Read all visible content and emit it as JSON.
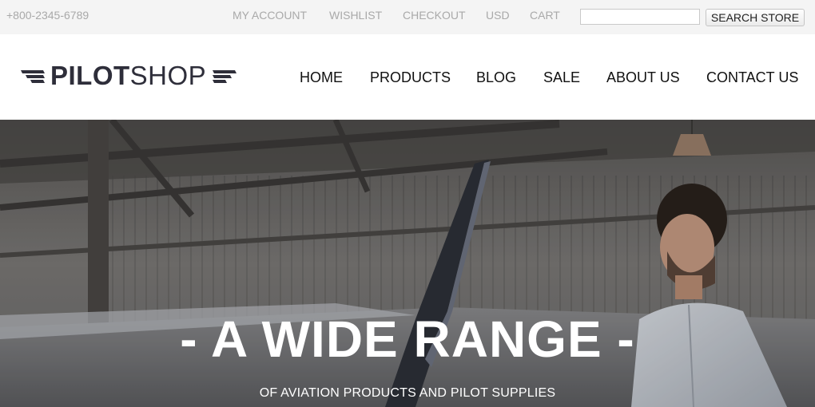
{
  "topbar": {
    "phone": "+800-2345-6789",
    "links": {
      "my_account": "MY ACCOUNT",
      "wishlist": "WISHLIST",
      "checkout": "CHECKOUT",
      "currency": "USD",
      "cart": "CART"
    },
    "search": {
      "value": "",
      "button_label": "SEARCH STORE"
    }
  },
  "header": {
    "logo": {
      "bold_part": "PILOT",
      "light_part": "SHOP"
    },
    "nav": {
      "home": "HOME",
      "products": "PRODUCTS",
      "blog": "BLOG",
      "sale": "SALE",
      "about": "ABOUT US",
      "contact": "CONTACT US"
    }
  },
  "hero": {
    "title": "- A WIDE RANGE -",
    "subtitle": "OF AVIATION PRODUCTS AND PILOT SUPPLIES"
  },
  "colors": {
    "topbar_bg": "#f4f4f4",
    "topbar_text": "#a9a9a9",
    "logo": "#2e2e3a",
    "nav_text": "#111111",
    "hero_text": "#ffffff"
  },
  "icons": [
    "wing-left-icon",
    "wing-right-icon"
  ]
}
